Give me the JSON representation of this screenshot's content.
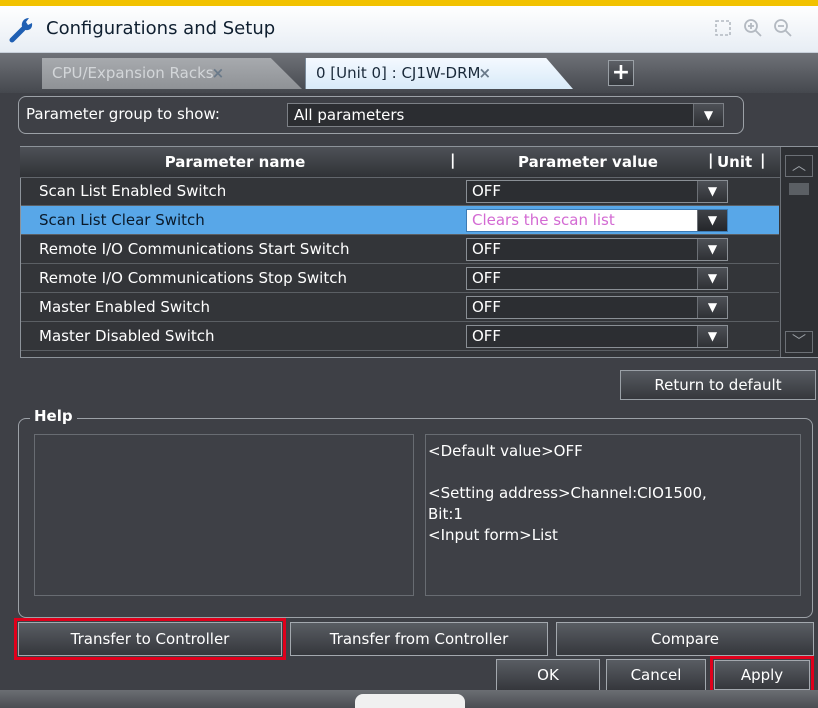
{
  "window": {
    "title": "Configurations and Setup",
    "title_icon": "wrench-icon",
    "tools": [
      "maximize-icon",
      "zoom-in-icon",
      "zoom-out-icon"
    ]
  },
  "tabs": [
    {
      "label": "CPU/Expansion Racks",
      "close": "×",
      "active": false
    },
    {
      "label": "0 [Unit 0] : CJ1W-DRM",
      "close": "×",
      "active": true
    }
  ],
  "tab_add_label": "+",
  "param_group": {
    "label": "Parameter group to show:",
    "value": "All parameters",
    "drop_glyph": "▼"
  },
  "table": {
    "headers": {
      "name": "Parameter name",
      "value": "Parameter value",
      "unit": "Unit",
      "separator": "|"
    },
    "rows": [
      {
        "name": "Scan List Enabled Switch",
        "value": "OFF",
        "selected": false
      },
      {
        "name": "Scan List Clear Switch",
        "value": "Clears the scan list",
        "selected": true
      },
      {
        "name": "Remote I/O Communications Start Switch",
        "value": "OFF",
        "selected": false
      },
      {
        "name": "Remote I/O Communications Stop Switch",
        "value": "OFF",
        "selected": false
      },
      {
        "name": "Master Enabled Switch",
        "value": "OFF",
        "selected": false
      },
      {
        "name": "Master Disabled Switch",
        "value": "OFF",
        "selected": false
      }
    ],
    "drop_glyph": "▼"
  },
  "scrollbar": {
    "up": "︿",
    "down": "﹀"
  },
  "return_default_label": "Return to default",
  "help": {
    "label": "Help",
    "default_value": "<Default value>OFF",
    "setting_address_line1": "<Setting address>Channel:CIO1500,",
    "setting_address_line2": "Bit:1",
    "input_form": "<Input form>List"
  },
  "buttons": {
    "transfer_to": "Transfer to Controller",
    "transfer_from": "Transfer from Controller",
    "compare": "Compare",
    "ok": "OK",
    "cancel": "Cancel",
    "apply": "Apply"
  },
  "colors": {
    "accent_top": "#f2c200",
    "selected_row": "#58a7e8",
    "selected_value_text": "#d36ad3",
    "highlight_outline": "#e0001b"
  }
}
